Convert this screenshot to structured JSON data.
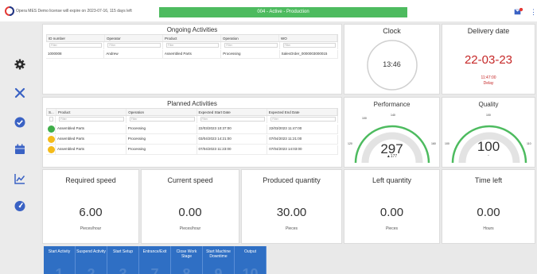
{
  "top_bar": {
    "license_text": "Opera MES Demo license will expire on 2023-07-16, 115 days left",
    "status_text": "004 - Active - Production",
    "colors": {
      "status": "#4dbb5f",
      "accent": "#2f6fc4",
      "delivery": "#c62828"
    }
  },
  "ongoing": {
    "title": "Ongoing Activities",
    "columns": [
      "ID number",
      "Operator",
      "Product",
      "Operation",
      "WO"
    ],
    "filter_placeholder": "Filter",
    "rows": [
      [
        "1000008",
        "Andrew",
        "Assembled Parts",
        "Processing",
        "SalesOrder_0000003000015"
      ]
    ]
  },
  "planned": {
    "title": "Planned Activities",
    "columns": [
      "S...",
      "Product",
      "Operation",
      "Expected Start Date",
      "Expected End Date"
    ],
    "filter_placeholder": "Filter",
    "rows": [
      {
        "status": "green",
        "product": "Assembled Parts",
        "operation": "Processing",
        "start": "22/03/2023 10:37:00",
        "end": "22/03/2023 11:47:00"
      },
      {
        "status": "yellow",
        "product": "Assembled Parts",
        "operation": "Processing",
        "start": "03/04/2023 14:21:00",
        "end": "07/04/2023 11:21:00"
      },
      {
        "status": "yellow",
        "product": "Assembled Parts",
        "operation": "Processing",
        "start": "07/04/2023 11:23:00",
        "end": "07/04/2023 14:03:00"
      }
    ]
  },
  "clock": {
    "title": "Clock",
    "time": "13:46"
  },
  "delivery": {
    "title": "Delivery date",
    "date": "22-03-23",
    "time": "11:47:00",
    "status": "Delay"
  },
  "performance": {
    "title": "Performance",
    "value": "297",
    "delta": "▲177",
    "ticks": [
      "100",
      "140",
      "120",
      "160"
    ]
  },
  "quality": {
    "title": "Quality",
    "value": "100",
    "sub": "-",
    "ticks": [
      "100",
      "100",
      "110"
    ]
  },
  "metrics": [
    {
      "label": "Required speed",
      "value": "6.00",
      "unit": "Pieces/hour"
    },
    {
      "label": "Current speed",
      "value": "0.00",
      "unit": "Pieces/hour"
    },
    {
      "label": "Produced quantity",
      "value": "30.00",
      "unit": "Pieces"
    },
    {
      "label": "Left quantity",
      "value": "0.00",
      "unit": "Pieces"
    },
    {
      "label": "Time left",
      "value": "0.00",
      "unit": "Hours"
    }
  ],
  "sidebar_icons": [
    "gear-icon",
    "tools-icon",
    "check-circle-icon",
    "calendar-icon",
    "chart-icon",
    "speedometer-icon"
  ],
  "actions": [
    {
      "label": "Start Activity",
      "num": "1"
    },
    {
      "label": "Suspend Activity",
      "num": "2"
    },
    {
      "label": "Start Setup",
      "num": "3"
    },
    {
      "label": "Entrance/Exit",
      "num": "7"
    },
    {
      "label": "Close Work Stage",
      "num": "8"
    },
    {
      "label": "Start Machine Downtime",
      "num": "9"
    },
    {
      "label": "Output",
      "num": "10"
    }
  ]
}
